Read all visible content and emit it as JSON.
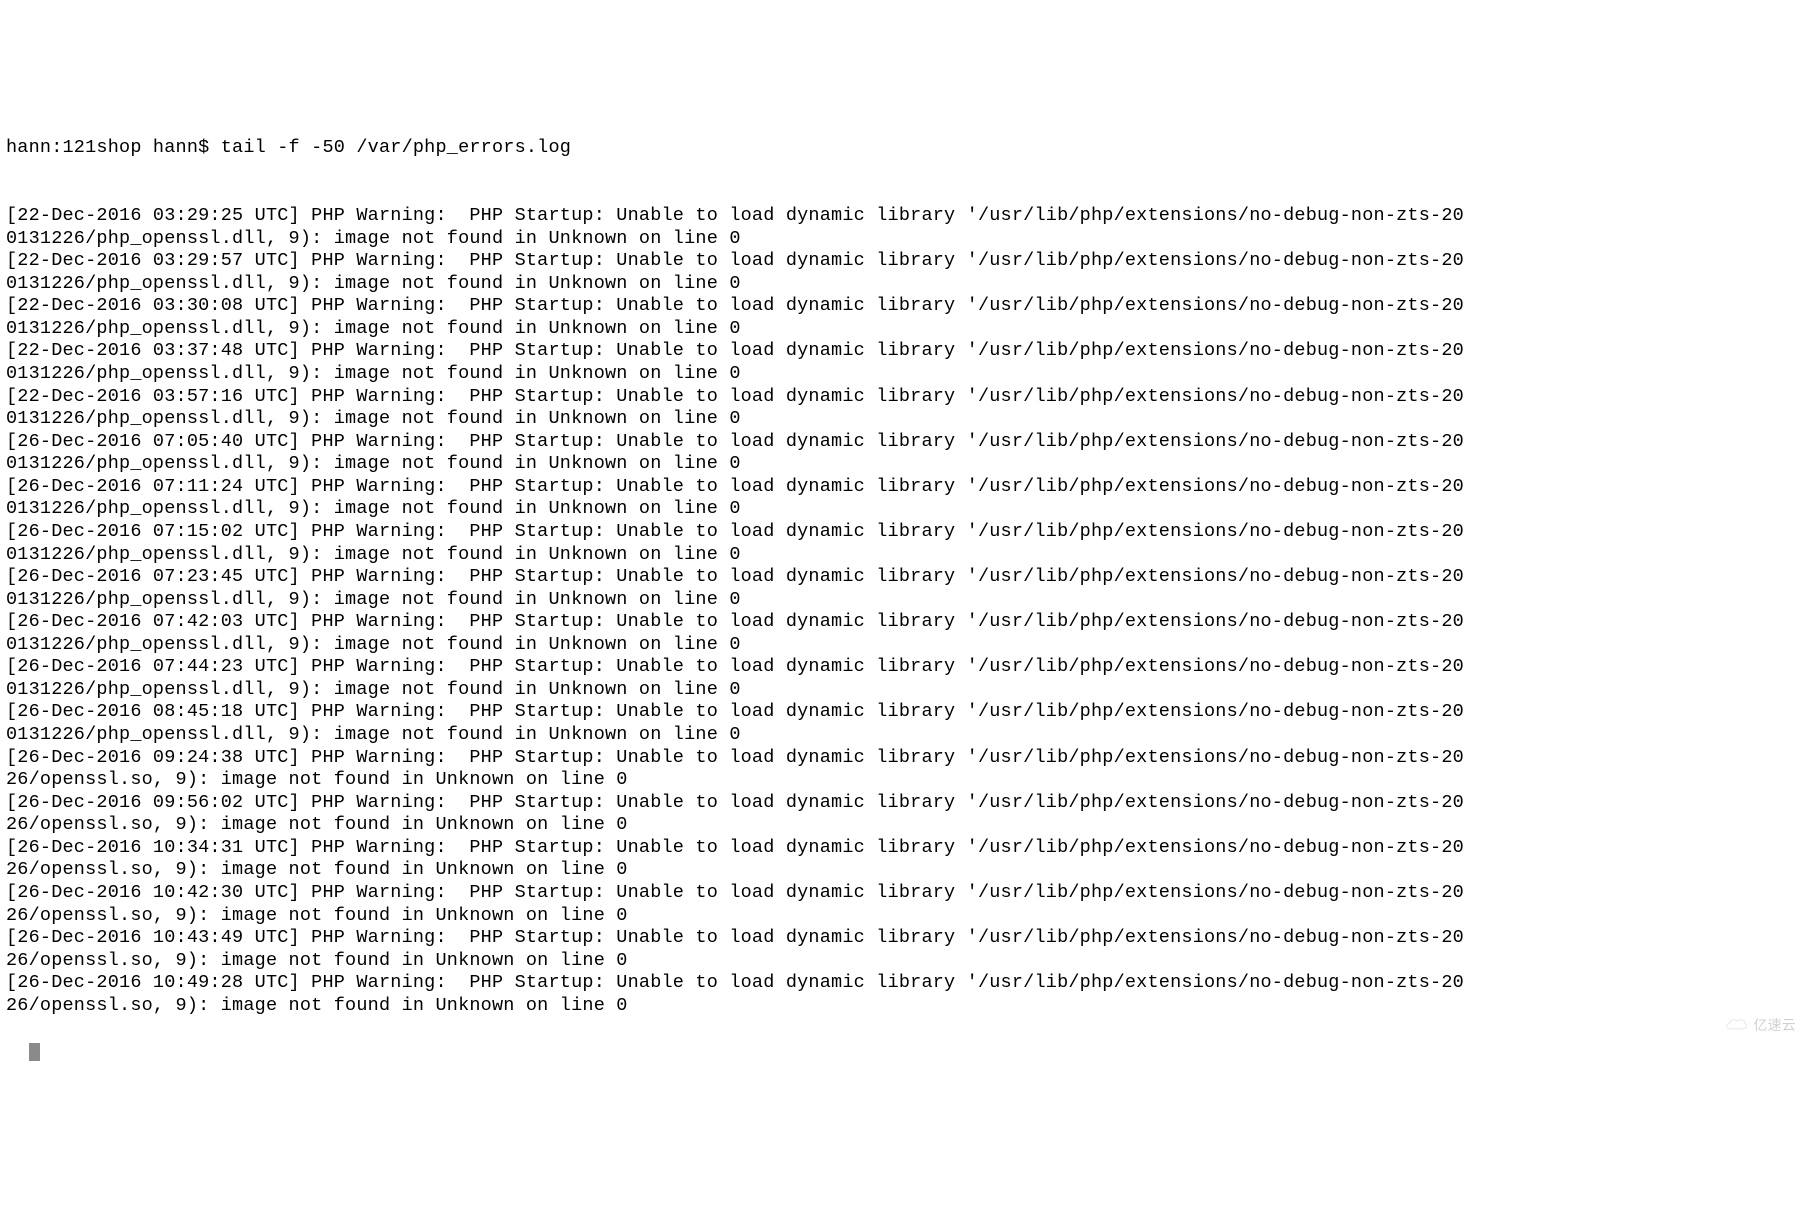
{
  "terminal": {
    "prompt": "hann:121shop hann$ tail -f -50 /var/php_errors.log",
    "lines": [
      "[22-Dec-2016 03:29:25 UTC] PHP Warning:  PHP Startup: Unable to load dynamic library '/usr/lib/php/extensions/no-debug-non-zts-20",
      "0131226/php_openssl.dll, 9): image not found in Unknown on line 0",
      "[22-Dec-2016 03:29:57 UTC] PHP Warning:  PHP Startup: Unable to load dynamic library '/usr/lib/php/extensions/no-debug-non-zts-20",
      "0131226/php_openssl.dll, 9): image not found in Unknown on line 0",
      "[22-Dec-2016 03:30:08 UTC] PHP Warning:  PHP Startup: Unable to load dynamic library '/usr/lib/php/extensions/no-debug-non-zts-20",
      "0131226/php_openssl.dll, 9): image not found in Unknown on line 0",
      "[22-Dec-2016 03:37:48 UTC] PHP Warning:  PHP Startup: Unable to load dynamic library '/usr/lib/php/extensions/no-debug-non-zts-20",
      "0131226/php_openssl.dll, 9): image not found in Unknown on line 0",
      "[22-Dec-2016 03:57:16 UTC] PHP Warning:  PHP Startup: Unable to load dynamic library '/usr/lib/php/extensions/no-debug-non-zts-20",
      "0131226/php_openssl.dll, 9): image not found in Unknown on line 0",
      "[26-Dec-2016 07:05:40 UTC] PHP Warning:  PHP Startup: Unable to load dynamic library '/usr/lib/php/extensions/no-debug-non-zts-20",
      "0131226/php_openssl.dll, 9): image not found in Unknown on line 0",
      "[26-Dec-2016 07:11:24 UTC] PHP Warning:  PHP Startup: Unable to load dynamic library '/usr/lib/php/extensions/no-debug-non-zts-20",
      "0131226/php_openssl.dll, 9): image not found in Unknown on line 0",
      "[26-Dec-2016 07:15:02 UTC] PHP Warning:  PHP Startup: Unable to load dynamic library '/usr/lib/php/extensions/no-debug-non-zts-20",
      "0131226/php_openssl.dll, 9): image not found in Unknown on line 0",
      "[26-Dec-2016 07:23:45 UTC] PHP Warning:  PHP Startup: Unable to load dynamic library '/usr/lib/php/extensions/no-debug-non-zts-20",
      "0131226/php_openssl.dll, 9): image not found in Unknown on line 0",
      "[26-Dec-2016 07:42:03 UTC] PHP Warning:  PHP Startup: Unable to load dynamic library '/usr/lib/php/extensions/no-debug-non-zts-20",
      "0131226/php_openssl.dll, 9): image not found in Unknown on line 0",
      "[26-Dec-2016 07:44:23 UTC] PHP Warning:  PHP Startup: Unable to load dynamic library '/usr/lib/php/extensions/no-debug-non-zts-20",
      "0131226/php_openssl.dll, 9): image not found in Unknown on line 0",
      "[26-Dec-2016 08:45:18 UTC] PHP Warning:  PHP Startup: Unable to load dynamic library '/usr/lib/php/extensions/no-debug-non-zts-20",
      "0131226/php_openssl.dll, 9): image not found in Unknown on line 0",
      "[26-Dec-2016 09:24:38 UTC] PHP Warning:  PHP Startup: Unable to load dynamic library '/usr/lib/php/extensions/no-debug-non-zts-20",
      "26/openssl.so, 9): image not found in Unknown on line 0",
      "[26-Dec-2016 09:56:02 UTC] PHP Warning:  PHP Startup: Unable to load dynamic library '/usr/lib/php/extensions/no-debug-non-zts-20",
      "26/openssl.so, 9): image not found in Unknown on line 0",
      "[26-Dec-2016 10:34:31 UTC] PHP Warning:  PHP Startup: Unable to load dynamic library '/usr/lib/php/extensions/no-debug-non-zts-20",
      "26/openssl.so, 9): image not found in Unknown on line 0",
      "[26-Dec-2016 10:42:30 UTC] PHP Warning:  PHP Startup: Unable to load dynamic library '/usr/lib/php/extensions/no-debug-non-zts-20",
      "26/openssl.so, 9): image not found in Unknown on line 0",
      "[26-Dec-2016 10:43:49 UTC] PHP Warning:  PHP Startup: Unable to load dynamic library '/usr/lib/php/extensions/no-debug-non-zts-20",
      "26/openssl.so, 9): image not found in Unknown on line 0",
      "[26-Dec-2016 10:49:28 UTC] PHP Warning:  PHP Startup: Unable to load dynamic library '/usr/lib/php/extensions/no-debug-non-zts-20",
      "26/openssl.so, 9): image not found in Unknown on line 0"
    ]
  },
  "watermark": {
    "text": "亿速云"
  }
}
